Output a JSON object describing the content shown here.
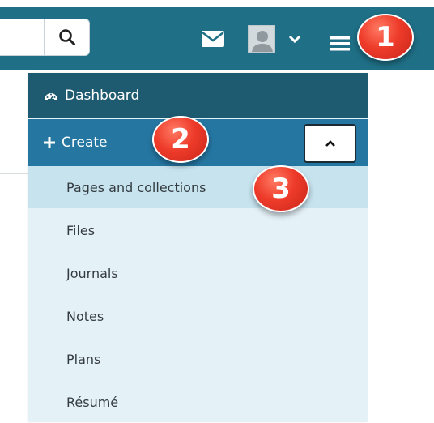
{
  "colors": {
    "topbar": "#1f6f86",
    "dashboard_bg": "#1f5b70",
    "create_bg": "#2577a2",
    "submenu_bg": "#e4f1f7",
    "submenu_active_bg": "#c7e3ee",
    "badge": "#ee3b2a"
  },
  "header": {
    "search_input_value": "",
    "search_icon": "search-icon",
    "mail_icon": "envelope-icon",
    "user_icon": "user-avatar-icon",
    "user_menu_icon": "chevron-down-icon",
    "main_menu_icon": "hamburger-icon"
  },
  "menu": {
    "dashboard": {
      "icon": "tachometer-icon",
      "label": "Dashboard"
    },
    "create": {
      "icon": "plus-icon",
      "label": "Create",
      "toggle_icon": "chevron-up-icon",
      "expanded": true
    },
    "create_items": [
      {
        "label": "Pages and collections",
        "active": true
      },
      {
        "label": "Files",
        "active": false
      },
      {
        "label": "Journals",
        "active": false
      },
      {
        "label": "Notes",
        "active": false
      },
      {
        "label": "Plans",
        "active": false
      },
      {
        "label": "Résumé",
        "active": false
      }
    ]
  },
  "callouts": [
    "1",
    "2",
    "3"
  ]
}
